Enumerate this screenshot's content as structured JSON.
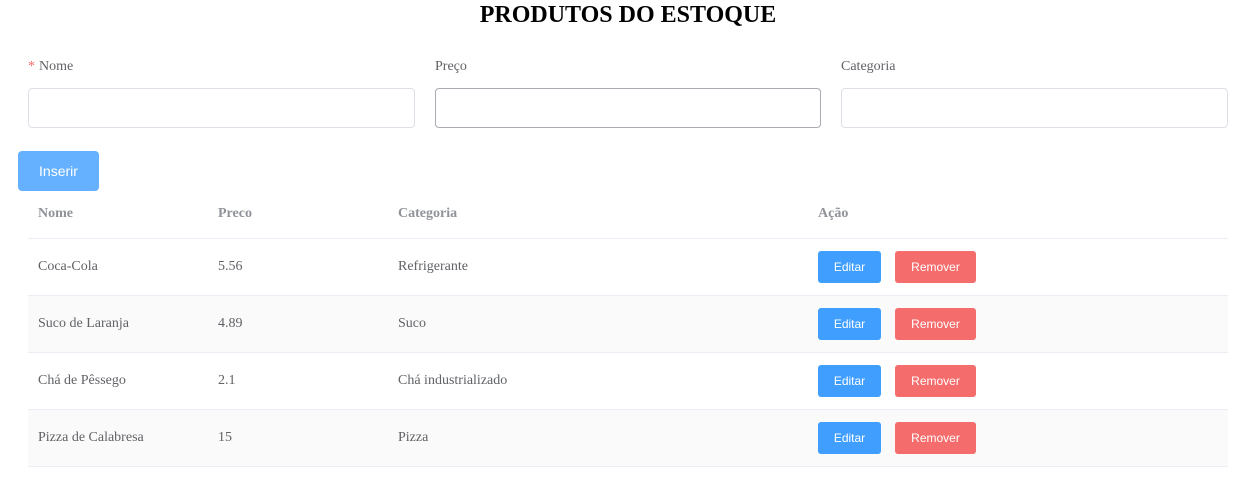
{
  "page": {
    "title": "PRODUTOS DO ESTOQUE"
  },
  "form": {
    "required_mark": "*",
    "nome_label": "Nome",
    "nome_value": "",
    "preco_label": "Preço",
    "preco_value": "",
    "categoria_label": "Categoria",
    "categoria_value": "",
    "insert_label": "Inserir"
  },
  "table": {
    "headers": [
      "Nome",
      "Preco",
      "Categoria",
      "Ação"
    ],
    "rows": [
      {
        "nome": "Coca-Cola",
        "preco": "5.56",
        "categoria": "Refrigerante"
      },
      {
        "nome": "Suco de Laranja",
        "preco": "4.89",
        "categoria": "Suco"
      },
      {
        "nome": "Chá de Pêssego",
        "preco": "2.1",
        "categoria": "Chá industrializado"
      },
      {
        "nome": "Pizza de Calabresa",
        "preco": "15",
        "categoria": "Pizza"
      }
    ],
    "edit_label": "Editar",
    "remove_label": "Remover"
  },
  "colors": {
    "primary": "#409eff",
    "primary_light": "#66b1ff",
    "danger": "#f56c6c"
  }
}
